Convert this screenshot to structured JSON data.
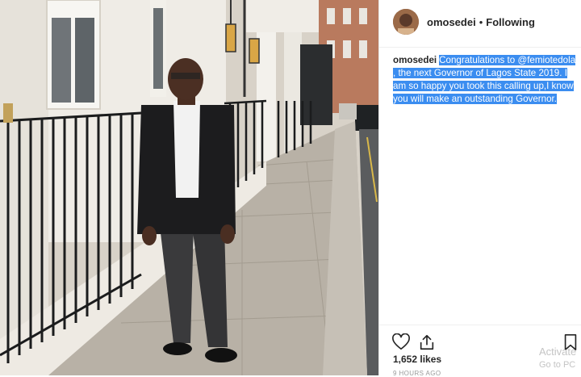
{
  "post": {
    "username": "omosedei",
    "separator": "•",
    "follow_status": "Following",
    "caption_user": "omosedei",
    "caption_text": "Congratulations to @femiotedola , the next Governor of Lagos State 2019. I am so happy you took this calling up,I know you will make an outstanding Governor.",
    "likes": "1,652 likes",
    "timestamp": "9 HOURS AGO"
  },
  "icons": {
    "like": "heart-icon",
    "share": "share-icon",
    "save": "bookmark-icon"
  },
  "watermark": {
    "line1": "Activate",
    "line2": "Go to PC"
  },
  "colors": {
    "selection": "#3b8df0",
    "text": "#262626",
    "muted": "#999999"
  }
}
